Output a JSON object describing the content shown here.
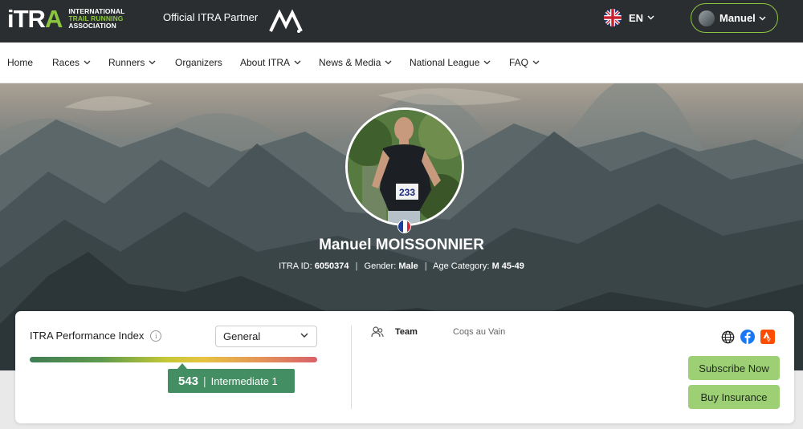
{
  "header": {
    "logo_mark_i": "iTR",
    "logo_mark_a": "A",
    "logo_line1": "INTERNATIONAL",
    "logo_line2": "TRAIL RUNNING",
    "logo_line3": "ASSOCIATION",
    "partner_text": "Official ITRA Partner",
    "language": "EN",
    "user_name": "Manuel"
  },
  "nav": {
    "items": [
      {
        "label": "Home",
        "dropdown": false
      },
      {
        "label": "Races",
        "dropdown": true
      },
      {
        "label": "Runners",
        "dropdown": true
      },
      {
        "label": "Organizers",
        "dropdown": false
      },
      {
        "label": "About ITRA",
        "dropdown": true
      },
      {
        "label": "News & Media",
        "dropdown": true
      },
      {
        "label": "National League",
        "dropdown": true
      },
      {
        "label": "FAQ",
        "dropdown": true
      }
    ]
  },
  "profile": {
    "name": "Manuel MOISSONNIER",
    "bib_number": "233",
    "itra_id_label": "ITRA ID:",
    "itra_id": "6050374",
    "gender_label": "Gender:",
    "gender": "Male",
    "age_label": "Age Category:",
    "age_category": "M 45-49",
    "country_flag": "france-flag"
  },
  "performance": {
    "label": "ITRA Performance Index",
    "selected_option": "General",
    "score": "543",
    "level": "Intermediate 1",
    "gauge_position_fraction": 0.53
  },
  "team": {
    "label": "Team",
    "value": "Coqs au Vain"
  },
  "socials": [
    "globe-icon",
    "facebook-icon",
    "strava-icon"
  ],
  "actions": {
    "subscribe": "Subscribe Now",
    "insurance": "Buy Insurance"
  },
  "colors": {
    "topbar": "#2b2e31",
    "brand_green": "#8cc63f",
    "score_green": "#438f63",
    "button_green": "#9dd075"
  }
}
